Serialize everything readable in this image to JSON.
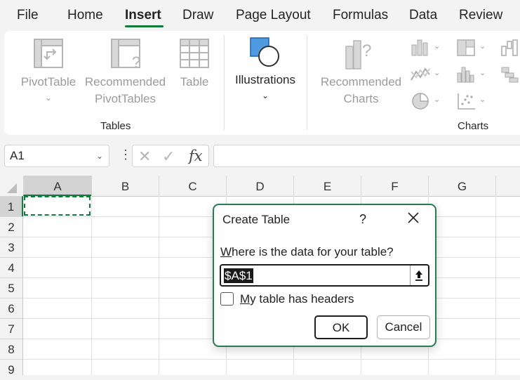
{
  "tabs": [
    {
      "label": "File"
    },
    {
      "label": "Home"
    },
    {
      "label": "Insert",
      "active": true
    },
    {
      "label": "Draw"
    },
    {
      "label": "Page Layout"
    },
    {
      "label": "Formulas"
    },
    {
      "label": "Data"
    },
    {
      "label": "Review"
    }
  ],
  "ribbon": {
    "tables_group": {
      "label": "Tables",
      "pivottable": "PivotTable",
      "recommended_pivot_line1": "Recommended",
      "recommended_pivot_line2": "PivotTables",
      "table": "Table"
    },
    "illustrations": "Illustrations",
    "charts_group": {
      "label": "Charts",
      "recommended_line1": "Recommended",
      "recommended_line2": "Charts"
    },
    "chevron": "⌄",
    "small_chevron": "⌄"
  },
  "formula_bar": {
    "name_box": "A1",
    "name_box_dropdown": "⌄",
    "dots": "⋮",
    "cancel_glyph": "✕",
    "enter_glyph": "✓",
    "fx": "fx",
    "value": ""
  },
  "grid": {
    "columns": [
      "A",
      "B",
      "C",
      "D",
      "E",
      "F",
      "G"
    ],
    "rows": [
      "1",
      "2",
      "3",
      "4",
      "5",
      "6",
      "7",
      "8",
      "9"
    ],
    "active_cell": "A1"
  },
  "dialog": {
    "title": "Create Table",
    "help": "?",
    "prompt_accel": "W",
    "prompt_rest": "here is the data for your table?",
    "range_value": "$A$1",
    "checkbox_accel": "M",
    "checkbox_rest": "y table has headers",
    "checkbox_checked": false,
    "ok": "OK",
    "cancel": "Cancel"
  },
  "colors": {
    "accent": "#117a3c",
    "dialog_border": "#2a7a52",
    "icon_blue": "#4f9ae0"
  }
}
